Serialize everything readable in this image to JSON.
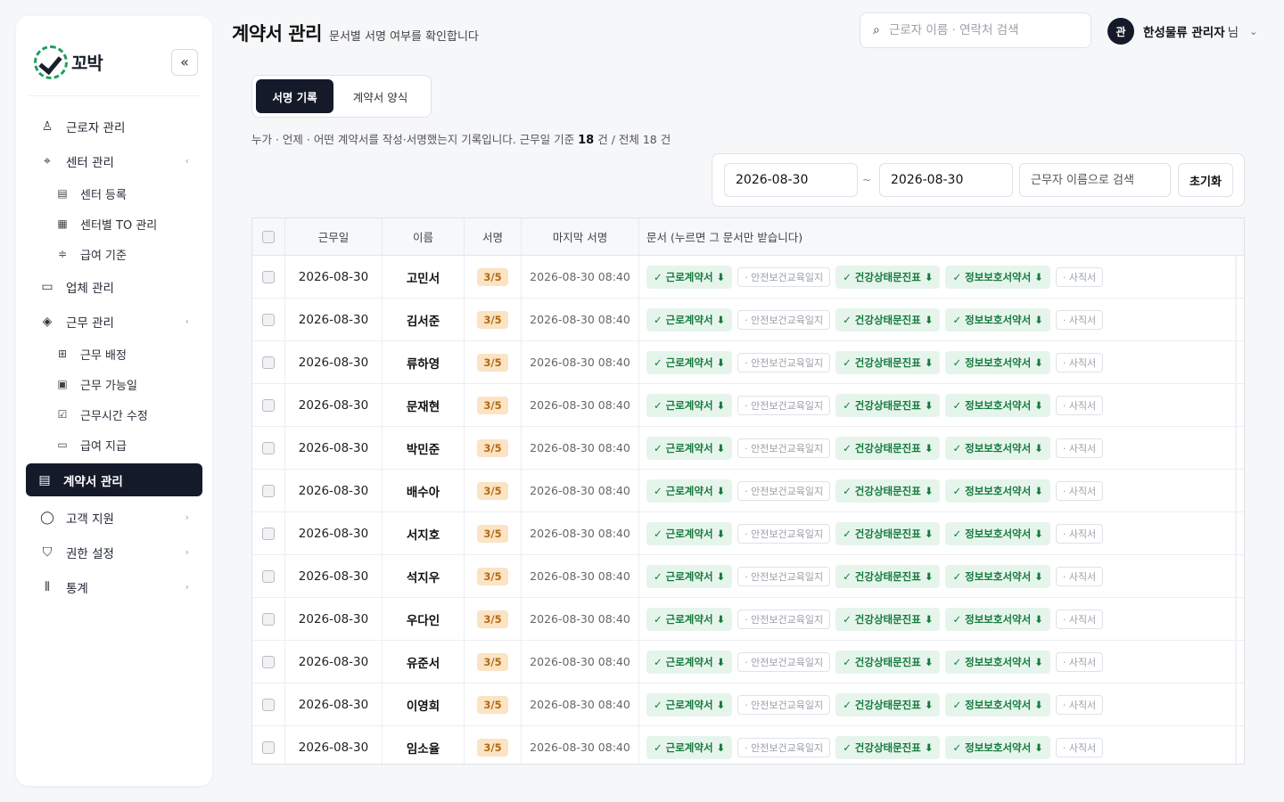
{
  "app": {
    "logo_text": "꼬박",
    "collapse_glyph": "«"
  },
  "sidebar": {
    "items": [
      {
        "label": "근로자 관리",
        "icon": "user-icon",
        "glyph": "♙",
        "type": "top"
      },
      {
        "label": "센터 관리",
        "icon": "location-pin-icon",
        "glyph": "⌖",
        "type": "top",
        "chev": "‹"
      },
      {
        "label": "센터 등록",
        "icon": "document-icon",
        "glyph": "▤",
        "type": "sub"
      },
      {
        "label": "센터별 TO 관리",
        "icon": "grid-icon",
        "glyph": "▦",
        "type": "sub"
      },
      {
        "label": "급여 기준",
        "icon": "sliders-icon",
        "glyph": "≑",
        "type": "sub"
      },
      {
        "label": "업체 관리",
        "icon": "briefcase-icon",
        "glyph": "▭",
        "type": "top"
      },
      {
        "label": "근무 관리",
        "icon": "layers-icon",
        "glyph": "◈",
        "type": "top",
        "chev": "‹"
      },
      {
        "label": "근무 배정",
        "icon": "plus-square-icon",
        "glyph": "⊞",
        "type": "sub"
      },
      {
        "label": "근무 가능일",
        "icon": "calendar-icon",
        "glyph": "▣",
        "type": "sub"
      },
      {
        "label": "근무시간 수정",
        "icon": "check-square-icon",
        "glyph": "☑",
        "type": "sub"
      },
      {
        "label": "급여 지급",
        "icon": "cash-icon",
        "glyph": "▭",
        "type": "sub"
      },
      {
        "label": "계약서 관리",
        "icon": "contract-icon",
        "glyph": "▤",
        "type": "active"
      },
      {
        "label": "고객 지원",
        "icon": "chat-icon",
        "glyph": "◯",
        "type": "top",
        "chev": "›"
      },
      {
        "label": "권한 설정",
        "icon": "shield-icon",
        "glyph": "⛉",
        "type": "top",
        "chev": "›"
      },
      {
        "label": "통계",
        "icon": "bar-chart-icon",
        "glyph": "⫴",
        "type": "top",
        "chev": "›"
      }
    ]
  },
  "header": {
    "title": "계약서 관리",
    "subtitle": "문서별 서명 여부를 확인합니다",
    "search_placeholder": "근로자 이름 · 연락처 검색",
    "user_avatar": "관",
    "user_name": "한성물류 관리자",
    "user_suffix": "님"
  },
  "tabs": [
    {
      "label": "서명 기록"
    },
    {
      "label": "계약서 양식"
    }
  ],
  "description": {
    "prefix": "누가 · 언제 · 어떤 계약서를 작성·서명했는지 기록입니다. 근무일 기준",
    "count": "18",
    "suffix": "건 / 전체 18 건"
  },
  "filters": {
    "date_from": "2026-08-30",
    "tilde": "~",
    "date_to": "2026-08-30",
    "name_placeholder": "근무자 이름으로 검색",
    "reset_label": "초기화"
  },
  "table": {
    "headers": {
      "date": "근무일",
      "name": "이름",
      "sign": "서명",
      "last": "마지막 서명",
      "docs": "문서 (누르면 그 문서만 받습니다)"
    },
    "documents": [
      {
        "label": "✓ 근로계약서 ⬇",
        "signed": true
      },
      {
        "label": "· 안전보건교육일지",
        "signed": false
      },
      {
        "label": "✓ 건강상태문진표 ⬇",
        "signed": true
      },
      {
        "label": "✓ 정보보호서약서 ⬇",
        "signed": true
      },
      {
        "label": "· 사직서",
        "signed": false
      }
    ],
    "rows": [
      {
        "date": "2026-08-30",
        "name": "고민서",
        "sign": "3/5",
        "last": "2026-08-30 08:40"
      },
      {
        "date": "2026-08-30",
        "name": "김서준",
        "sign": "3/5",
        "last": "2026-08-30 08:40"
      },
      {
        "date": "2026-08-30",
        "name": "류하영",
        "sign": "3/5",
        "last": "2026-08-30 08:40"
      },
      {
        "date": "2026-08-30",
        "name": "문재현",
        "sign": "3/5",
        "last": "2026-08-30 08:40"
      },
      {
        "date": "2026-08-30",
        "name": "박민준",
        "sign": "3/5",
        "last": "2026-08-30 08:40"
      },
      {
        "date": "2026-08-30",
        "name": "배수아",
        "sign": "3/5",
        "last": "2026-08-30 08:40"
      },
      {
        "date": "2026-08-30",
        "name": "서지호",
        "sign": "3/5",
        "last": "2026-08-30 08:40"
      },
      {
        "date": "2026-08-30",
        "name": "석지우",
        "sign": "3/5",
        "last": "2026-08-30 08:40"
      },
      {
        "date": "2026-08-30",
        "name": "우다인",
        "sign": "3/5",
        "last": "2026-08-30 08:40"
      },
      {
        "date": "2026-08-30",
        "name": "유준서",
        "sign": "3/5",
        "last": "2026-08-30 08:40"
      },
      {
        "date": "2026-08-30",
        "name": "이영희",
        "sign": "3/5",
        "last": "2026-08-30 08:40"
      },
      {
        "date": "2026-08-30",
        "name": "임소율",
        "sign": "3/5",
        "last": "2026-08-30 08:40"
      }
    ]
  },
  "colors": {
    "accent_dark": "#141a29",
    "signed_bg": "#e6f5ec",
    "signed_text": "#157a3d",
    "badge_bg": "#fbe3c4",
    "badge_text": "#b26a12"
  }
}
